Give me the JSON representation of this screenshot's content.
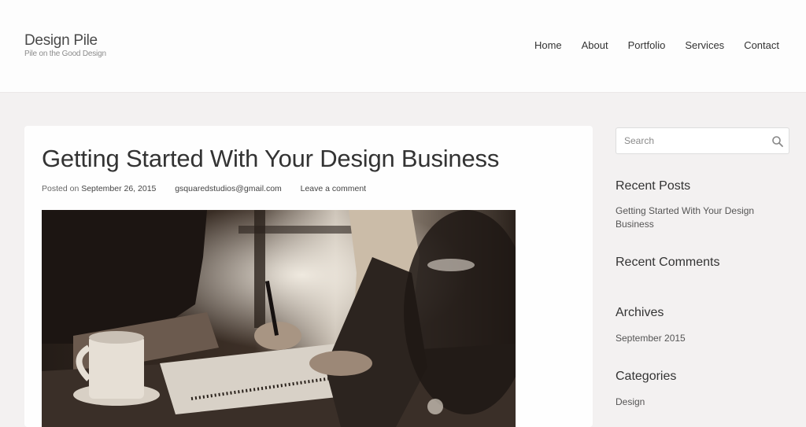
{
  "site": {
    "title": "Design Pile",
    "tagline": "Pile on the Good Design"
  },
  "nav": {
    "items": [
      "Home",
      "About",
      "Portfolio",
      "Services",
      "Contact"
    ]
  },
  "post": {
    "title": "Getting Started With Your Design Business",
    "posted_on_label": "Posted on",
    "date": "September 26, 2015",
    "author": "gsquaredstudios@gmail.com",
    "comment_link": "Leave a comment"
  },
  "sidebar": {
    "search_placeholder": "Search",
    "recent_posts_title": "Recent Posts",
    "recent_posts": [
      "Getting Started With Your Design Business"
    ],
    "recent_comments_title": "Recent Comments",
    "archives_title": "Archives",
    "archives": [
      "September 2015"
    ],
    "categories_title": "Categories",
    "categories": [
      "Design"
    ]
  },
  "colors": {
    "page_background": "#f3f1f1",
    "header_background": "#fdfdfd",
    "text": "#333333"
  },
  "icons": {
    "search": "magnifier-icon"
  }
}
